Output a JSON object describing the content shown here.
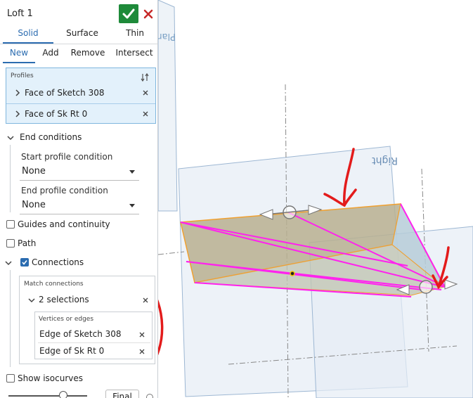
{
  "feature": {
    "title": "Loft 1",
    "accept_label": "Accept",
    "cancel_label": "Cancel"
  },
  "body_type_tabs": [
    {
      "label": "Solid",
      "active": true
    },
    {
      "label": "Surface",
      "active": false
    },
    {
      "label": "Thin",
      "active": false
    }
  ],
  "operation_tabs": [
    {
      "label": "New",
      "active": true
    },
    {
      "label": "Add",
      "active": false
    },
    {
      "label": "Remove",
      "active": false
    },
    {
      "label": "Intersect",
      "active": false
    }
  ],
  "profiles": {
    "label": "Profiles",
    "items": [
      "Face of Sketch 308",
      "Face of Sk Rt 0"
    ]
  },
  "end_conditions": {
    "label": "End conditions",
    "start_label": "Start profile condition",
    "start_value": "None",
    "end_label": "End profile condition",
    "end_value": "None"
  },
  "options": {
    "guides_label": "Guides and continuity",
    "path_label": "Path",
    "connections_label": "Connections",
    "connections_checked": true,
    "show_isocurves_label": "Show isocurves"
  },
  "connections": {
    "match_label": "Match connections",
    "selection_count_label": "2 selections",
    "vertices_label": "Vertices or edges",
    "edges": [
      "Edge of Sketch 308",
      "Edge of Sk Rt 0"
    ]
  },
  "bottom": {
    "final_label": "Final"
  },
  "viewport": {
    "plane_top_label": "Plane",
    "plane_right_label": "Right"
  },
  "colors": {
    "accent": "#2b6cb0",
    "ok_green": "#1e8a3a",
    "cancel_red": "#c62828",
    "profile_bg": "#e3f1fb",
    "loft_edge": "#ff22ee",
    "sketch_outline": "#f0a030",
    "annotation_red": "#e31b1b"
  }
}
